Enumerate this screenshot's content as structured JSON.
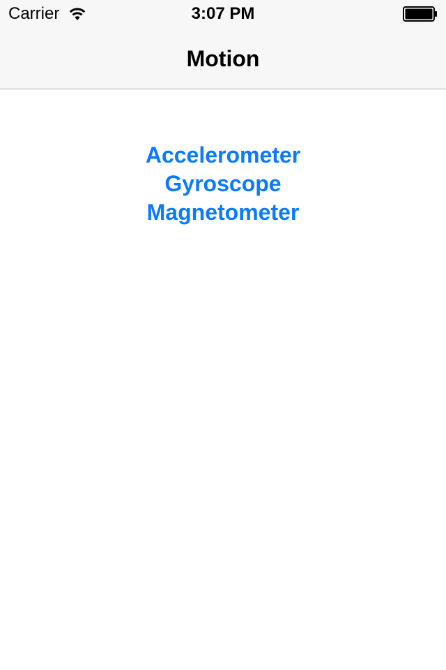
{
  "status_bar": {
    "carrier": "Carrier",
    "time": "3:07 PM",
    "wifi_icon": "wifi-icon",
    "battery_icon": "battery-icon",
    "battery_level": 1.0
  },
  "nav_bar": {
    "title": "Motion"
  },
  "menu": {
    "items": [
      {
        "label": "Accelerometer"
      },
      {
        "label": "Gyroscope"
      },
      {
        "label": "Magnetometer"
      }
    ]
  },
  "colors": {
    "accent": "#0a7aff",
    "nav_background": "#f7f7f7",
    "separator": "#b2b2b2",
    "text": "#000000",
    "background": "#ffffff"
  }
}
